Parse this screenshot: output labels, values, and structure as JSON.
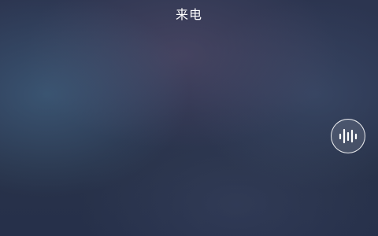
{
  "call_screen": {
    "title": "来电"
  },
  "voice_button": {
    "icon": "audio-waveform-icon"
  }
}
